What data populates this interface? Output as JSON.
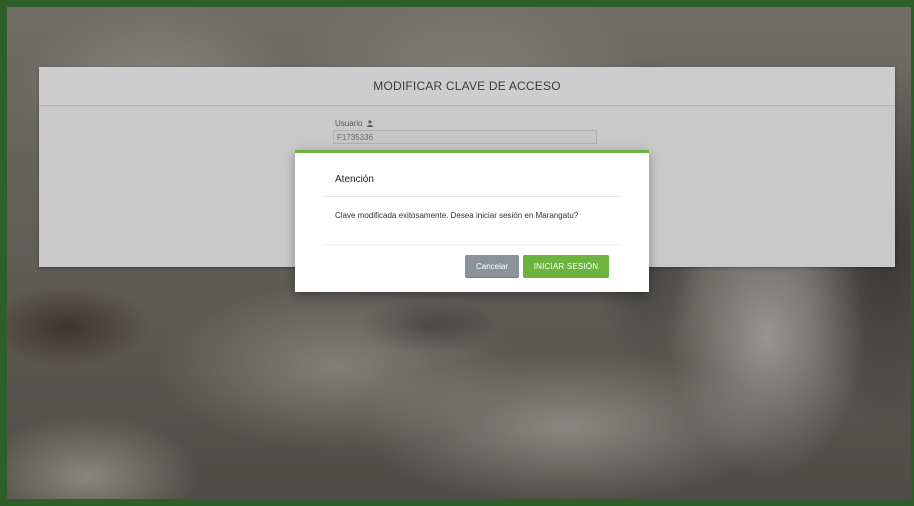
{
  "page": {
    "title": "MODIFICAR CLAVE DE ACCESO",
    "user_field": {
      "label": "Usuario",
      "value": "F1735336"
    }
  },
  "modal": {
    "title": "Atención",
    "message": "Clave modificada exitosamente. Desea iniciar sesión en Marangatu?",
    "cancel_label": "Cancelar",
    "login_label": "INICIAR SESIÓN"
  },
  "icons": {
    "user": "user-icon"
  },
  "colors": {
    "accent": "#6db33f",
    "cancel": "#8a939b",
    "frame": "#2f5e2a"
  }
}
